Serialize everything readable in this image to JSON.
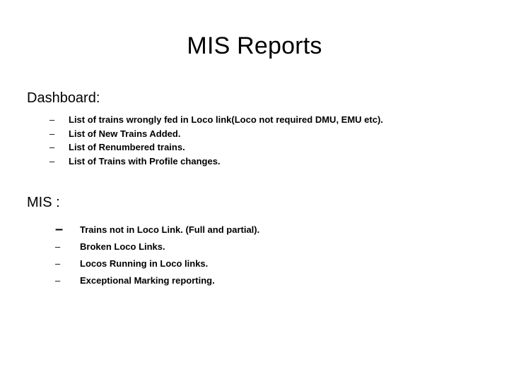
{
  "slide": {
    "title": "MIS Reports",
    "background_color": "#FFFFFF",
    "text_color": "#000000",
    "sections": [
      {
        "heading": "Dashboard:",
        "bullet_marker": "–",
        "items": [
          "List of trains wrongly fed in Loco link(Loco not required DMU, EMU etc).",
          "List of New Trains Added.",
          "List of Renumbered trains.",
          "List of Trains with Profile changes."
        ]
      },
      {
        "heading": "MIS :",
        "bullet_marker": "–",
        "items": [
          "Trains not in Loco Link. (Full and partial).",
          "Broken Loco Links.",
          "Locos Running in Loco links.",
          "Exceptional Marking reporting."
        ]
      }
    ]
  }
}
